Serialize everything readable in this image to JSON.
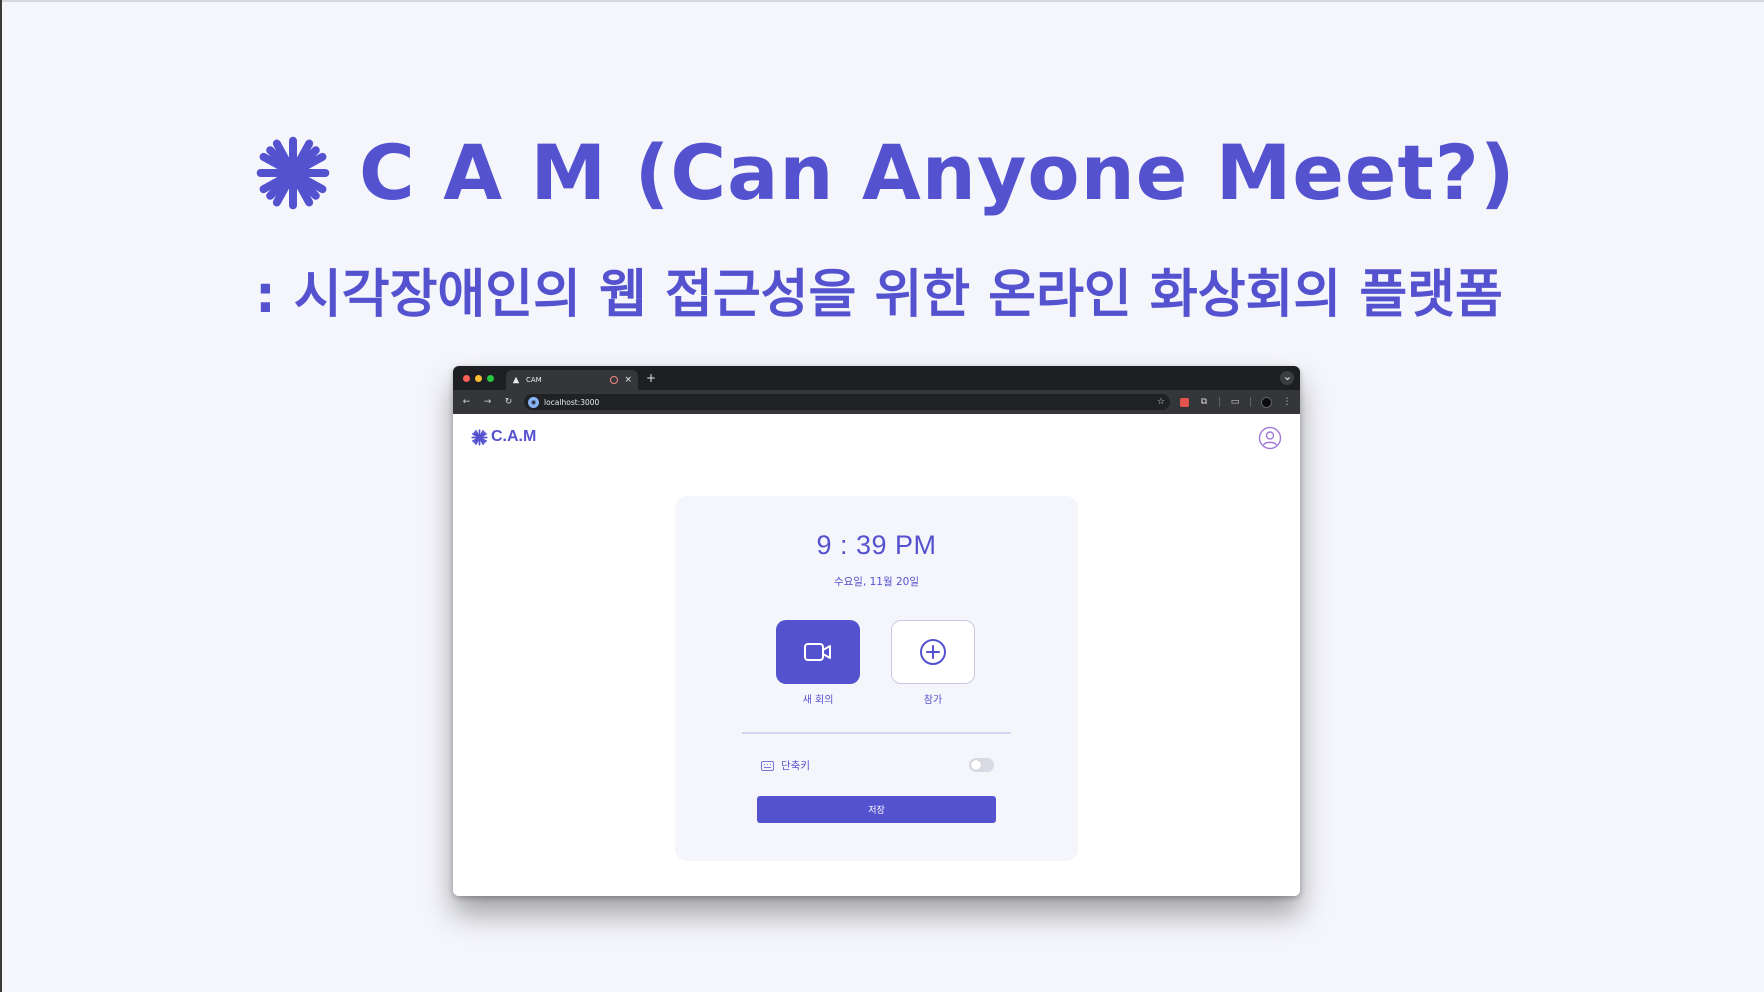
{
  "slide": {
    "title": "C A M (Can Anyone Meet?)",
    "subtitle": ": 시각장애인의 웹 접근성을 위한 온라인 화상회의 플랫폼",
    "accent_color": "#5552cf"
  },
  "browser": {
    "tab_title": "CAM",
    "url": "localhost:3000",
    "new_tab_label": "+",
    "close_label": "×"
  },
  "app": {
    "logo_text": "C.A.M",
    "time": "9 : 39 PM",
    "date": "수요일, 11월 20일",
    "new_meeting_label": "새 회의",
    "join_label": "참가",
    "shortcut_label": "단축키",
    "shortcut_enabled": false,
    "save_label": "저장"
  }
}
